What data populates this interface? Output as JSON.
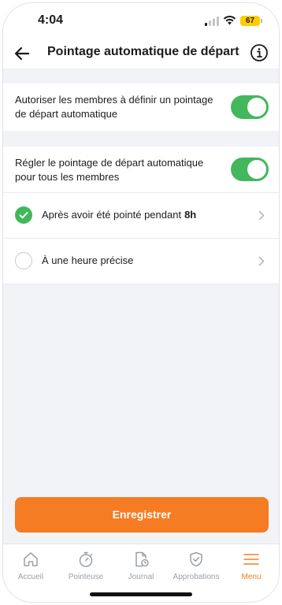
{
  "status_bar": {
    "time": "4:04",
    "battery": "67"
  },
  "header": {
    "title": "Pointage automatique de départ"
  },
  "settings": {
    "allow_members": {
      "line1": "Autoriser les membres à définir un pointage",
      "line2": "de départ automatique",
      "enabled": true
    },
    "set_all_members": {
      "line1": "Régler le pointage de départ automatique",
      "line2": "pour tous les membres",
      "enabled": true
    }
  },
  "options": [
    {
      "label": "Après avoir été pointé pendant",
      "value": "8h",
      "selected": true
    },
    {
      "label": "À une heure précise",
      "value": "",
      "selected": false
    }
  ],
  "save_button": {
    "label": "Enregistrer"
  },
  "tabs": [
    {
      "label": "Accueil",
      "icon": "home-icon"
    },
    {
      "label": "Pointeuse",
      "icon": "stopwatch-icon"
    },
    {
      "label": "Journal",
      "icon": "timesheet-icon"
    },
    {
      "label": "Approbations",
      "icon": "shield-check-icon"
    },
    {
      "label": "Menu",
      "icon": "menu-icon",
      "active": true
    }
  ],
  "colors": {
    "accent": "#f57c22",
    "toggle_on": "#43b75b",
    "background": "#f2f3f7"
  }
}
